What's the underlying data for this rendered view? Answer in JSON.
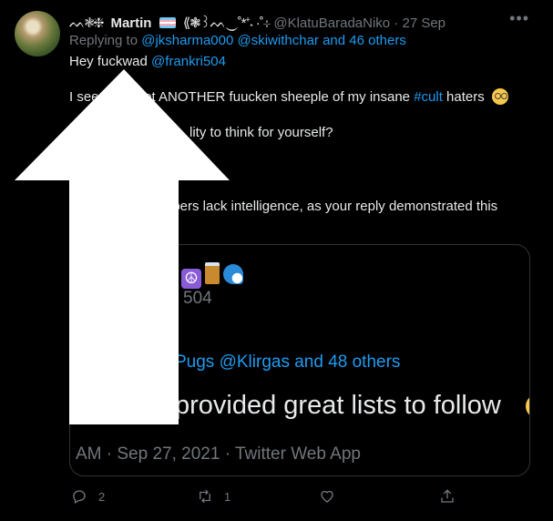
{
  "tweet": {
    "name_prefix": "ᨓ❃❈",
    "name": "Martin",
    "name_suffix": "⟪❃꒱ᨓ‿˚*⁺˖ ·˚⊹",
    "handle": "@KlatuBaradaNiko",
    "dot": "·",
    "date": "27 Sep",
    "replying_prefix": "Replying to",
    "reply_mentions": "@jksharma000 @skiwithchar",
    "reply_others": "and 46 others",
    "line1_text": "Hey fuckwad",
    "line1_mention": "@frankri504",
    "line2_start": "I see",
    "line2_mid": "yet ANOTHER fuucken sheeple of my insane",
    "line2_hashtag": "#cult",
    "line2_end": "haters",
    "line3": "lity to think for yourself?",
    "line4": "ipers lack intelligence, as your reply demonstrated this"
  },
  "quote": {
    "emoji_peace": "☮",
    "handle": "504",
    "reply_line": "Pugs @Klirgas and 48 others",
    "text": "provided great lists to follow",
    "meta": "AM · Sep 27, 2021 · Twitter Web App"
  },
  "actions": {
    "reply_count": "2",
    "retweet_count": "1"
  },
  "colors": {
    "background": "#000000",
    "link": "#1d9bf0",
    "secondary": "#71767b",
    "arrow": "#ffffff"
  },
  "icons": {
    "more": "more-icon",
    "reply": "reply-icon",
    "retweet": "retweet-icon",
    "like": "heart-icon",
    "share": "share-icon",
    "arrow": "up-arrow-overlay"
  }
}
